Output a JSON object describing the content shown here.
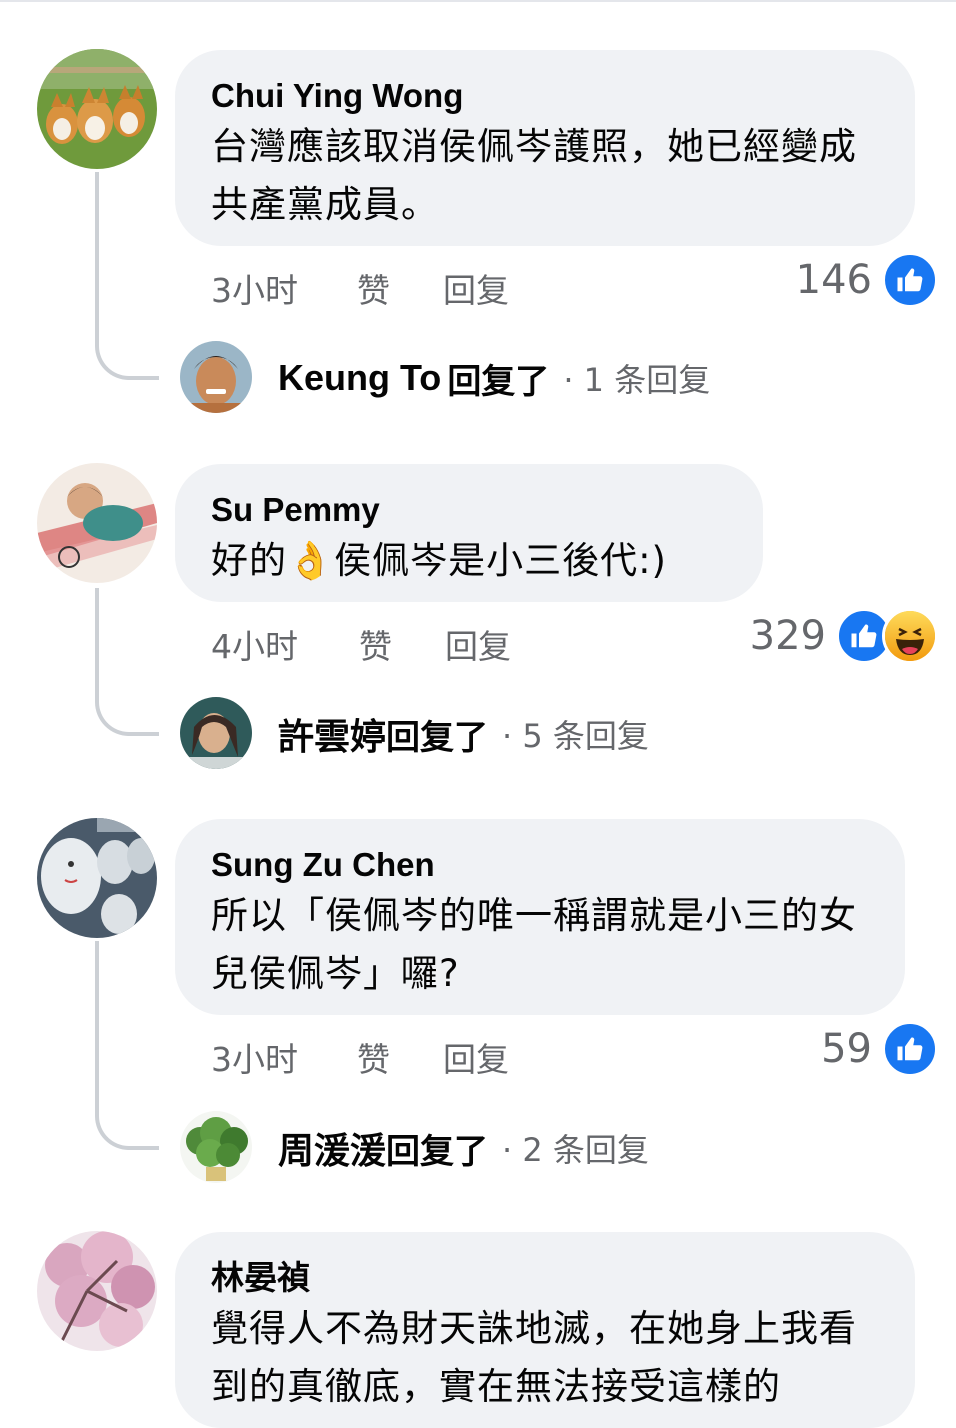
{
  "comments": [
    {
      "author": "Chui Ying Wong",
      "text": "台灣應該取消侯佩岑護照，她已經變成共產黨成員。",
      "time": "3小时",
      "like_label": "赞",
      "reply_label": "回复",
      "reaction_count": "146",
      "reactions": [
        "like-icon"
      ],
      "replies": {
        "name": "Keung To",
        "verb": "回复了",
        "count_text": "· 1 条回复"
      }
    },
    {
      "author": "Su Pemmy",
      "text_before": "好的",
      "emoji": "👌",
      "text_after": "侯佩岑是小三後代:)",
      "time": "4小时",
      "like_label": "赞",
      "reply_label": "回复",
      "reaction_count": "329",
      "reactions": [
        "like-icon",
        "haha-icon"
      ],
      "replies": {
        "name": "許雲婷",
        "verb": "回复了",
        "count_text": "· 5 条回复"
      }
    },
    {
      "author": "Sung Zu Chen",
      "text": "所以「侯佩岑的唯一稱謂就是小三的女兒侯佩岑」囉?",
      "time": "3小时",
      "like_label": "赞",
      "reply_label": "回复",
      "reaction_count": "59",
      "reactions": [
        "like-icon"
      ],
      "replies": {
        "name": "周湲湲",
        "verb": "回复了",
        "count_text": "· 2 条回复"
      }
    },
    {
      "author": "林晏禎",
      "text": "覺得人不為財天誅地滅，在她身上我看到的真徹底，實在無法接受這樣的"
    }
  ],
  "colors": {
    "bubble_bg": "#f0f2f5",
    "meta_text": "#65676b",
    "like_blue": "#1877f2",
    "thread_line": "#ccd0d5"
  }
}
